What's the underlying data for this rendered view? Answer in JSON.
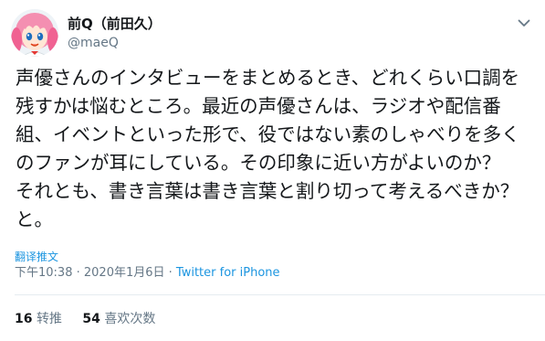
{
  "user": {
    "display_name": "前Q（前田久）",
    "handle": "@maeQ"
  },
  "tweet": {
    "text": "声優さんのインタビューをまとめるとき、どれくらい口調を残すかは悩むところ。最近の声優さんは、ラジオや配信番組、イベントといった形で、役ではない素のしゃべりを多くのファンが耳にしている。その印象に近い方がよいのか？　それとも、書き言葉は書き言葉と割り切って考えるべきか？　と。",
    "translate_label": "翻译推文",
    "time": "下午10:38",
    "separator": " · ",
    "date": "2020年1月6日",
    "source": "Twitter for iPhone"
  },
  "stats": {
    "retweets_count": "16",
    "retweets_label": "转推",
    "likes_count": "54",
    "likes_label": "喜欢次数"
  },
  "colors": {
    "text": "#14171a",
    "secondary": "#657786",
    "link": "#1b95e0",
    "divider": "#e6ecf0"
  },
  "icons": {
    "caret": "chevron-down-icon",
    "avatar": "anime-girl-avatar"
  }
}
